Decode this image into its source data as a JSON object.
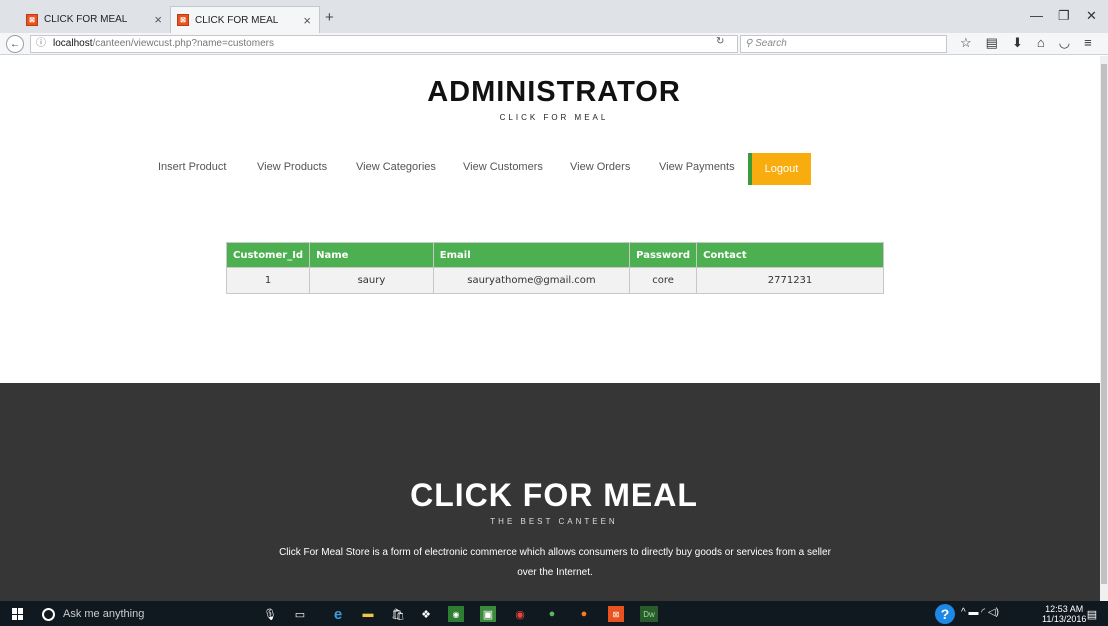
{
  "browser": {
    "tabs": [
      {
        "label": "CLICK FOR MEAL"
      },
      {
        "label": "CLICK FOR MEAL"
      }
    ],
    "url_host": "localhost",
    "url_path": "/canteen/viewcust.php?name=customers",
    "search_placeholder": "Search"
  },
  "header": {
    "title": "ADMINISTRATOR",
    "subtitle": "CLICK FOR MEAL"
  },
  "menu": {
    "items": [
      "Insert Product",
      "View Products",
      "View Categories",
      "View Customers",
      "View Orders",
      "View Payments"
    ],
    "logout": "Logout"
  },
  "table": {
    "headers": [
      "Customer_Id",
      "Name",
      "Email",
      "Password",
      "Contact"
    ],
    "rows": [
      [
        "1",
        "saury",
        "sauryathome@gmail.com",
        "core",
        "2771231"
      ]
    ]
  },
  "footer": {
    "title": "CLICK FOR MEAL",
    "subtitle": "THE BEST CANTEEN",
    "description": "Click For Meal Store is a form of electronic commerce which allows consumers to directly buy goods or services from a seller over the Internet."
  },
  "taskbar": {
    "search_placeholder": "Ask me anything",
    "time": "12:53 AM",
    "date": "11/13/2016"
  },
  "colors": {
    "table_header": "#4caf50",
    "logout_bg": "#f9ac0d",
    "footer_bg": "#363636"
  }
}
